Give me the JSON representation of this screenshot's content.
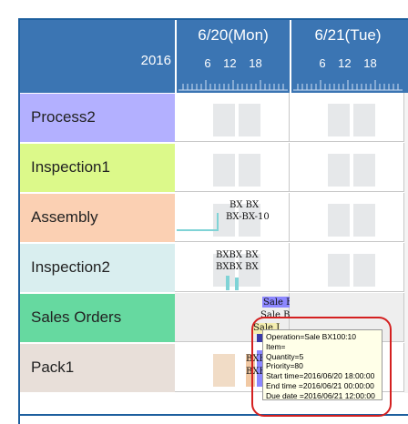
{
  "header": {
    "year": "2016",
    "days": [
      {
        "label": "6/20(Mon)",
        "ticks": "6 12 18"
      },
      {
        "label": "6/21(Tue)",
        "ticks": "6 12 18"
      }
    ]
  },
  "rows": [
    {
      "label": "Process2",
      "color": "#b3b0ff"
    },
    {
      "label": "Inspection1",
      "color": "#dcf98a"
    },
    {
      "label": "Assembly",
      "color": "#fbd0b3"
    },
    {
      "label": "Inspection2",
      "color": "#d9eeef"
    },
    {
      "label": "Sales Orders",
      "color": "#66d9a0"
    },
    {
      "label": "Pack1",
      "color": "#e8dfd9"
    }
  ],
  "bars": {
    "assembly_1": "BX BX",
    "assembly_2": "BX-BX-10",
    "inspection2_1": "BXBX BX",
    "inspection2_2": "BXBX BX",
    "sales_1": "Sale BX100",
    "sales_2": "Sale BX",
    "sales_3": "Sale J",
    "pack_1": "BXBX10",
    "pack_2": "BXBX10"
  },
  "tooltip": {
    "operation": "Operation=Sale BX100:10",
    "item": "Item=",
    "quantity": "Quantity=5",
    "priority": "Priority=80",
    "start": "Start time=2016/06/20 18:00:00",
    "end": "End time =2016/06/21 00:00:00",
    "due": "Due date =2016/06/21 12:00:00"
  },
  "colors": {
    "header": "#3b75b3",
    "frame": "#1d5f9e",
    "highlight_ring": "#d42020"
  }
}
